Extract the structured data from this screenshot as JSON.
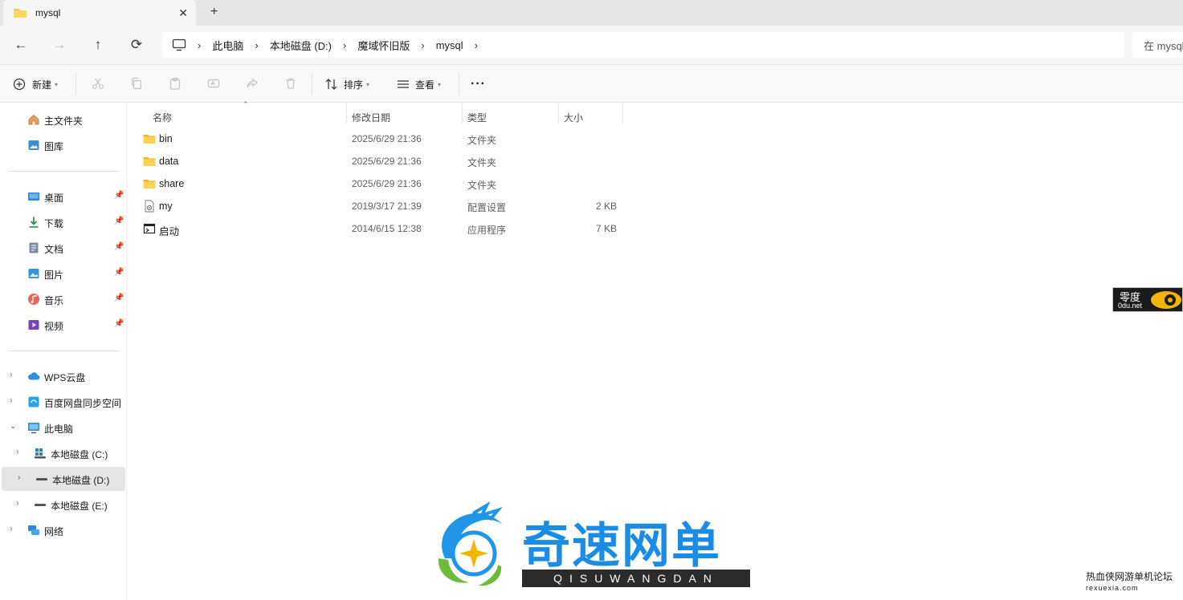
{
  "tab": {
    "title": "mysql",
    "close_glyph": "✕",
    "new_glyph": "+"
  },
  "nav": {
    "back": "←",
    "forward": "→",
    "up": "↑",
    "refresh": "⟳",
    "breadcrumbs": [
      "此电脑",
      "本地磁盘 (D:)",
      "魔域怀旧版",
      "mysql"
    ],
    "search_placeholder": "在 mysql"
  },
  "toolbar": {
    "new_label": "新建",
    "sort_label": "排序",
    "view_label": "查看",
    "more_label": "···"
  },
  "sidebar": {
    "quick": [
      {
        "label": "主文件夹",
        "icon": "home-icon"
      },
      {
        "label": "图库",
        "icon": "gallery-icon"
      }
    ],
    "pinned": [
      {
        "label": "桌面",
        "icon": "desktop-icon"
      },
      {
        "label": "下载",
        "icon": "download-icon"
      },
      {
        "label": "文档",
        "icon": "document-icon"
      },
      {
        "label": "图片",
        "icon": "pictures-icon"
      },
      {
        "label": "音乐",
        "icon": "music-icon"
      },
      {
        "label": "视频",
        "icon": "video-icon"
      }
    ],
    "tree": [
      {
        "label": "WPS云盘",
        "icon": "cloud-icon"
      },
      {
        "label": "百度网盘同步空间",
        "icon": "baidu-sync-icon"
      },
      {
        "label": "此电脑",
        "icon": "computer-icon"
      },
      {
        "label": "本地磁盘 (C:)",
        "icon": "windows-drive-icon"
      },
      {
        "label": "本地磁盘 (D:)",
        "icon": "drive-icon"
      },
      {
        "label": "本地磁盘 (E:)",
        "icon": "drive-icon"
      },
      {
        "label": "网络",
        "icon": "network-icon"
      }
    ]
  },
  "columns": {
    "name": "名称",
    "date": "修改日期",
    "type": "类型",
    "size": "大小"
  },
  "files": [
    {
      "name": "bin",
      "date": "2025/6/29 21:36",
      "type": "文件夹",
      "size": "",
      "icon": "folder-icon"
    },
    {
      "name": "data",
      "date": "2025/6/29 21:36",
      "type": "文件夹",
      "size": "",
      "icon": "folder-icon"
    },
    {
      "name": "share",
      "date": "2025/6/29 21:36",
      "type": "文件夹",
      "size": "",
      "icon": "folder-icon"
    },
    {
      "name": "my",
      "date": "2019/3/17 21:39",
      "type": "配置设置",
      "size": "2 KB",
      "icon": "config-file-icon"
    },
    {
      "name": "启动",
      "date": "2014/6/15 12:38",
      "type": "应用程序",
      "size": "7 KB",
      "icon": "app-file-icon"
    }
  ],
  "watermarks": {
    "zero_du_title": "零度",
    "zero_du_url": "0du.net",
    "brand_title": "奇速网单",
    "brand_sub": "QISUWANGDAN",
    "forum_title": "热血侠网游单机论坛",
    "forum_url": "rexuexia.com"
  },
  "colors": {
    "folder": "#f6c343",
    "accent": "#0067c0",
    "brand": "#1a8ce6"
  }
}
